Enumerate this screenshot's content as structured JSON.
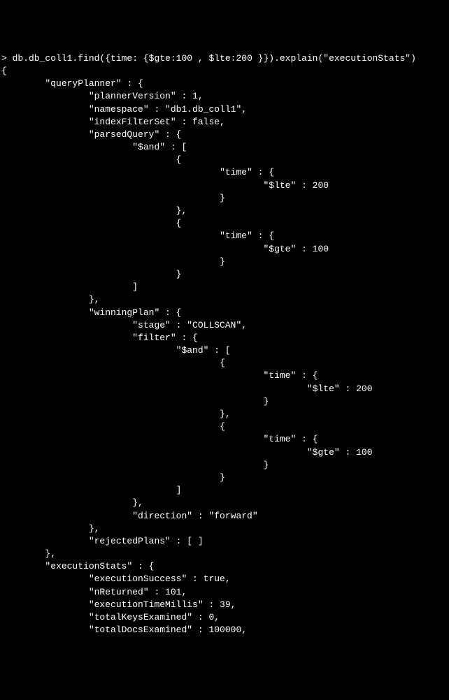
{
  "terminal": {
    "prompt": "> ",
    "command": "db.db_coll1.find({time: {$gte:100 , $lte:200 }}).explain(\"executionStats\")",
    "output_open": "{",
    "queryPlanner": {
      "key": "\"queryPlanner\" : {",
      "plannerVersion": "\"plannerVersion\" : 1,",
      "namespace": "\"namespace\" : \"db1.db_coll1\",",
      "indexFilterSet": "\"indexFilterSet\" : false,",
      "parsedQuery": {
        "key": "\"parsedQuery\" : {",
        "and_key": "\"$and\" : [",
        "obj1_open": "{",
        "time1_key": "\"time\" : {",
        "lte_line": "\"$lte\" : 200",
        "time1_close": "}",
        "obj1_close": "},",
        "obj2_open": "{",
        "time2_key": "\"time\" : {",
        "gte_line": "\"$gte\" : 100",
        "time2_close": "}",
        "obj2_close": "}",
        "and_close": "]",
        "close": "},"
      },
      "winningPlan": {
        "key": "\"winningPlan\" : {",
        "stage": "\"stage\" : \"COLLSCAN\",",
        "filter_key": "\"filter\" : {",
        "and_key": "\"$and\" : [",
        "obj1_open": "{",
        "time1_key": "\"time\" : {",
        "lte_line": "\"$lte\" : 200",
        "time1_close": "}",
        "obj1_close": "},",
        "obj2_open": "{",
        "time2_key": "\"time\" : {",
        "gte_line": "\"$gte\" : 100",
        "time2_close": "}",
        "obj2_close": "}",
        "and_close": "]",
        "filter_close": "},",
        "direction": "\"direction\" : \"forward\"",
        "close": "},"
      },
      "rejectedPlans": "\"rejectedPlans\" : [ ]",
      "close": "},"
    },
    "executionStats": {
      "key": "\"executionStats\" : {",
      "executionSuccess": "\"executionSuccess\" : true,",
      "nReturned": "\"nReturned\" : 101,",
      "executionTimeMillis": "\"executionTimeMillis\" : 39,",
      "totalKeysExamined": "\"totalKeysExamined\" : 0,",
      "totalDocsExamined": "\"totalDocsExamined\" : 100000,"
    }
  }
}
